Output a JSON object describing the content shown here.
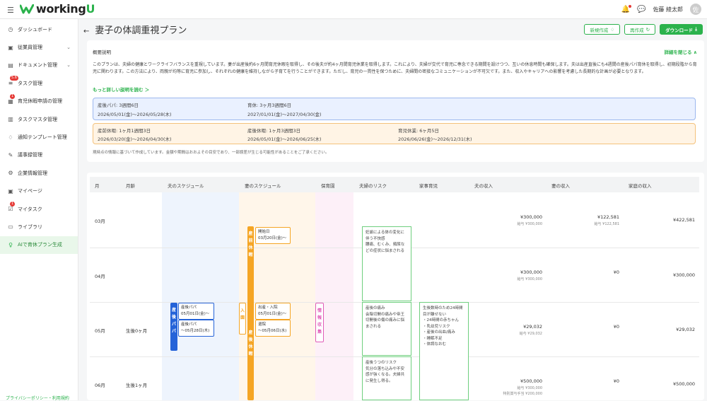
{
  "app": {
    "title_prefix": "working",
    "title_suffix": "U",
    "menu_icon": "hamburger-icon",
    "username": "佐藤 綾太郎",
    "avatar_initial": "佐"
  },
  "colors": {
    "accent": "#2bb24c",
    "blue": "#2563d8",
    "orange": "#f5a524",
    "pink": "#e05cb8"
  },
  "sidebar": {
    "items": [
      {
        "label": "ダッシュボード",
        "icon": "dashboard-icon",
        "chev": ""
      },
      {
        "label": "従業員管理",
        "icon": "employee-icon",
        "chev": "⌄"
      },
      {
        "label": "ドキュメント管理",
        "icon": "document-icon",
        "chev": "⌄"
      },
      {
        "label": "タスク管理",
        "icon": "task-icon",
        "chev": "",
        "badge": "5.6"
      },
      {
        "label": "育児休暇申請の管理",
        "icon": "leave-icon",
        "chev": "",
        "badge": "1"
      },
      {
        "label": "タスクマスタ管理",
        "icon": "task-master-icon",
        "chev": ""
      },
      {
        "label": "通知テンプレート管理",
        "icon": "notification-icon",
        "chev": ""
      },
      {
        "label": "議事録管理",
        "icon": "minutes-icon",
        "chev": ""
      },
      {
        "label": "企業情報管理",
        "icon": "company-icon",
        "chev": ""
      },
      {
        "label": "マイページ",
        "icon": "mypage-icon",
        "chev": ""
      },
      {
        "label": "マイタスク",
        "icon": "mytask-icon",
        "chev": "",
        "badge": "1"
      },
      {
        "label": "ライブラリ",
        "icon": "library-icon",
        "chev": ""
      },
      {
        "label": "AIで育休プラン生成",
        "icon": "ai-icon",
        "chev": ""
      }
    ],
    "privacy": "プライバシーポリシー・利用規約"
  },
  "header": {
    "back": "←",
    "title": "妻子の体調重視プラン",
    "buttons": {
      "new": "新規作成",
      "recreate": "再作成",
      "download": "ダウンロード"
    }
  },
  "overview": {
    "label": "概要説明",
    "close": "詳細を閉じる ∧",
    "text": "このプランは、夫婦の健康とワークライフバランスを重視しています。妻が出産後約6ヶ月間育児休暇を取得し、その後夫が約4ヶ月間育児休業を取得します。これにより、夫婦が交代で育児に専念できる期間を設けつつ、互いの休息時間も確保します。夫は出産直後にも4週間の産後パパ育休を取得し、初期段階から育児に関わります。この方法により、両親が均等に育児に参加し、それぞれの健康を維持しながら子育てを行うことができます。ただし、育児の一貫性を保つために、夫婦間の密接なコミュニケーションが不可欠です。また、収入やキャリアへの影響を考慮した長期的な計画が必要となります。",
    "more": "もっと詳しい説明を読む ＞",
    "husband": [
      {
        "title": "産後パパ: 3週間6日",
        "range": "2026/05/01(金)〜2026/05/28(木)"
      },
      {
        "title": "育休: 3ヶ月3週間6日",
        "range": "2027/01/01(金)〜2027/04/30(金)"
      }
    ],
    "wife": [
      {
        "title": "産前休暇: 1ヶ月1週間3日",
        "range": "2026/03/20(金)〜2026/04/30(木)"
      },
      {
        "title": "産後休暇: 1ヶ月3週間3日",
        "range": "2026/05/01(金)〜2026/06/25(木)"
      },
      {
        "title": "育児休業: 6ヶ月5日",
        "range": "2026/06/26(金)〜2026/12/31(木)"
      }
    ],
    "note": "現時点の情報に基づいて作成しています。金額や期間はおおよその目安であり、一部誤差が生じる可能性があることをご了承ください。"
  },
  "table": {
    "headers": [
      "月",
      "月齢",
      "夫のスケジュール",
      "妻のスケジュール",
      "保育園",
      "夫婦のリスク",
      "家事育児",
      "夫の収入",
      "妻の収入",
      "家庭の収入"
    ],
    "rows": [
      {
        "month": "03月",
        "age": "",
        "husband_income": "¥300,000",
        "husband_sub": "給与 ¥300,000",
        "wife_income": "¥122,581",
        "wife_sub": "給与 ¥122,581",
        "family": "¥422,581"
      },
      {
        "month": "04月",
        "age": "",
        "husband_income": "¥300,000",
        "husband_sub": "給与 ¥300,000",
        "wife_income": "¥0",
        "wife_sub": "",
        "family": "¥300,000"
      },
      {
        "month": "05月",
        "age": "生後0ヶ月",
        "husband_income": "¥29,032",
        "husband_sub": "給与 ¥29,032",
        "wife_income": "¥0",
        "wife_sub": "",
        "family": "¥29,032"
      },
      {
        "month": "06月",
        "age": "生後1ヶ月",
        "husband_income": "¥500,000",
        "husband_sub": "給与 ¥300,000",
        "husband_sub2": "特別賞与手当 ¥200,000",
        "wife_income": "¥0",
        "wife_sub": "",
        "family": "¥500,000"
      }
    ],
    "bars": {
      "papa": "産後パパ",
      "wife_prenatal": "産前休暇",
      "wife_postnatal": "産後休暇",
      "entry": "入園",
      "info": "情報収集"
    },
    "events": {
      "papa1": "産後パパ\n05月01日(金)〜",
      "papa2": "産後パパ\n〜05月28日(木)",
      "start": "開始日\n03月20日(金)〜",
      "birth": "出産・入院\n05月01日(金)〜",
      "discharge": "退院\n〜05月06日(水)"
    },
    "risks": {
      "r1": "妊娠による体の変化に伴う不快感\n腰痛、むくみ、頻尿などの症状に悩まされる",
      "r2": "産後の痛み\n会陰切開の痛みや帝王切開後の傷の痛みに悩まされる",
      "r3": "産後うつのリスク\n気分の落ち込みや不安感が強くなる。夫婦共に発生し得る。",
      "chores": "生後数時のため24時間目が離せない\n・24時間の赤ちゃん\n・乳幼児リスク\n・産後の出血/痛み\n・睡眠不足\n・体調なおむ"
    }
  }
}
